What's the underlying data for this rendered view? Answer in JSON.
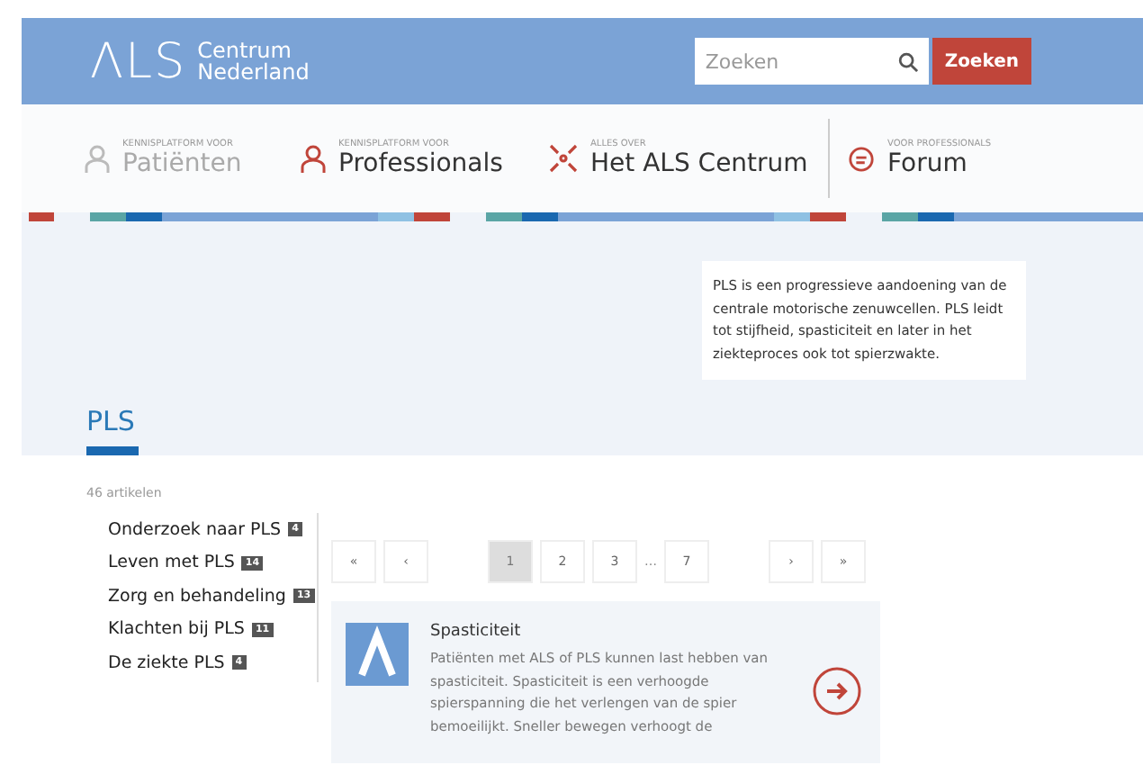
{
  "header": {
    "logo_mark": "ΛLS",
    "logo_text": [
      "Centrum",
      "Nederland"
    ],
    "search": {
      "placeholder": "Zoeken",
      "button": "Zoeken"
    }
  },
  "nav": [
    {
      "kicker": "KENNISPLATFORM VOOR",
      "label": "Patiënten",
      "kind": "person",
      "muted": true
    },
    {
      "kicker": "KENNISPLATFORM VOOR",
      "label": "Professionals",
      "kind": "person",
      "muted": false
    },
    {
      "kicker": "ALLES OVER",
      "label": "Het ALS Centrum",
      "kind": "arrows",
      "muted": false
    },
    {
      "kicker": "VOOR PROFESSIONALS",
      "label": "Forum",
      "kind": "chat",
      "muted": false
    }
  ],
  "intro": "PLS is een progressieve aandoening van de centrale motorische zenuwcellen. PLS leidt tot stijfheid, spasticiteit en later in het ziekteproces ook tot spierzwakte.",
  "page_title": "PLS",
  "article_count": "46 artikelen",
  "categories": [
    {
      "label": "Onderzoek naar PLS",
      "count": "4"
    },
    {
      "label": "Leven met PLS",
      "count": "14"
    },
    {
      "label": "Zorg en behandeling",
      "count": "13"
    },
    {
      "label": "Klachten bij PLS",
      "count": "11"
    },
    {
      "label": "De ziekte PLS",
      "count": "4"
    }
  ],
  "pagination": {
    "first": "«",
    "prev": "‹",
    "pages": [
      {
        "label": "1",
        "selected": true
      },
      {
        "label": "2",
        "selected": false
      },
      {
        "label": "3",
        "selected": false
      },
      {
        "label": "…",
        "kind": "gap"
      },
      {
        "label": "7",
        "selected": false
      }
    ],
    "next": "›",
    "last": "»"
  },
  "article": {
    "title": "Spasticiteit",
    "excerpt": "Patiënten met ALS of PLS kunnen last hebben van spasticiteit. Spasticiteit is een verhoogde spierspanning die het verlengen van de spier bemoeilijkt. Sneller bewegen verhoogt de"
  }
}
